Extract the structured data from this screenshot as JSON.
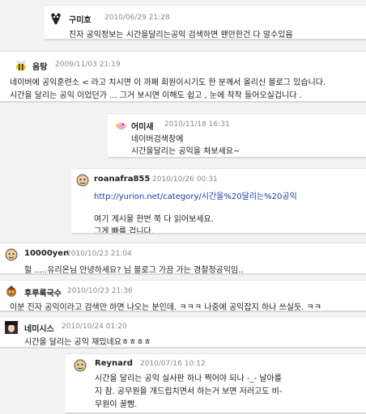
{
  "comments": [
    {
      "author": "구미호",
      "date": "2010/06/29 21:28",
      "lines": [
        "진자 공익정보는 시간을달리는공익 검색하면 왠만한건 다 알수있음"
      ]
    },
    {
      "author": "음탕",
      "date": "2009/11/03 21:19",
      "lines": [
        "네이버에 공익훈련소 < 라고 치시면 이 까페 회원이시기도 한 분께서 올리신 블로그 있습니다.",
        "시간을 달리는 공익 이었던가 ... 그거 보시면 이해도 쉽고 , 눈에 착착 들어오실겁니다 ."
      ]
    },
    {
      "author": "어미새",
      "date": "2010/11/18 16:31",
      "lines": [
        "네이버검색창에",
        "시간을달리는 공익을 쳐보세요~"
      ]
    },
    {
      "author": "roanafra855",
      "date": "2010/10/26 00:31",
      "link": "http://yurion.net/category/시간을%20달리는%20공익",
      "lines": [
        "여기 게시물 한번 쭉 다 읽어보세요.",
        "그게 빠를 겁니다."
      ]
    },
    {
      "author": "10000yen",
      "date": "2010/10/23 21:04",
      "lines": [
        "헐 .....유리온님 안녕하세요? 님 블로그 가끔 가는 경찰청공익임.."
      ]
    },
    {
      "author": "후루룩국수",
      "date": "2010/10/23 21:36",
      "lines": [
        "이분 진자 공익이라고 검색만 하면 나오는 분인데. ㅋㅋㅋ 나중에 공익잡지 하나 쓰실듯. ㅋㅋ"
      ]
    },
    {
      "author": "네미시스",
      "date": "2010/10/24 01:20",
      "lines": [
        "시간을 달리는 공익 재밌네요ㅎㅎㅎㅎ"
      ]
    },
    {
      "author": "Reynard",
      "date": "2010/07/16 10:12",
      "lines": [
        "시간을 달리는 공익 실사판 하나 찍어야 되나 -_- 날아를",
        "지 참. 공무원을 개드립치면서 하는거 보면 저러고도 비-",
        "무원이 꿀빰."
      ]
    }
  ],
  "icons": {
    "c0": "mask-icon",
    "c1": "bee-icon",
    "c2": "bird-icon",
    "c3": "face-icon",
    "c4": "face-icon",
    "c5": "character-icon",
    "c6": "photo-icon",
    "c7": "face-icon"
  },
  "colors": {
    "link": "#1a3aa8",
    "date": "#8a8a8a",
    "background": "#f3f3f3"
  }
}
